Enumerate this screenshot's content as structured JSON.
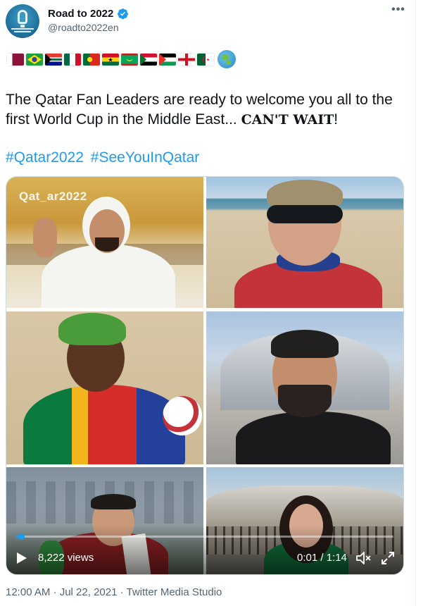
{
  "author": {
    "display_name": "Road to 2022",
    "handle": "@roadto2022en",
    "verified_icon": "verified-badge-icon"
  },
  "more_icon_glyph": "•••",
  "flags": [
    "qatar",
    "brazil",
    "south-africa",
    "mexico",
    "portugal",
    "ghana",
    "mauritania",
    "sudan",
    "palestine",
    "england",
    "algeria"
  ],
  "globe_icon": "globe-icon",
  "tweet": {
    "text": "The Qatar Fan Leaders are ready to welcome you all to the first World Cup in the Middle East... ",
    "emphasis": "CAN'T WAIT",
    "text_end": "!",
    "hashtags": [
      "#Qatar2022",
      "#SeeYouInQatar"
    ]
  },
  "video": {
    "watermark": "Qat_ar2022",
    "views": "8,222 views",
    "time": "0:01 / 1:14",
    "progress": 0.0135
  },
  "meta": {
    "timestamp": "12:00 AM · Jul 22, 2021 · Twitter Media Studio"
  },
  "colors": {
    "accent": "#1d9bf0",
    "text_primary": "#0f1419",
    "text_secondary": "#536471"
  }
}
